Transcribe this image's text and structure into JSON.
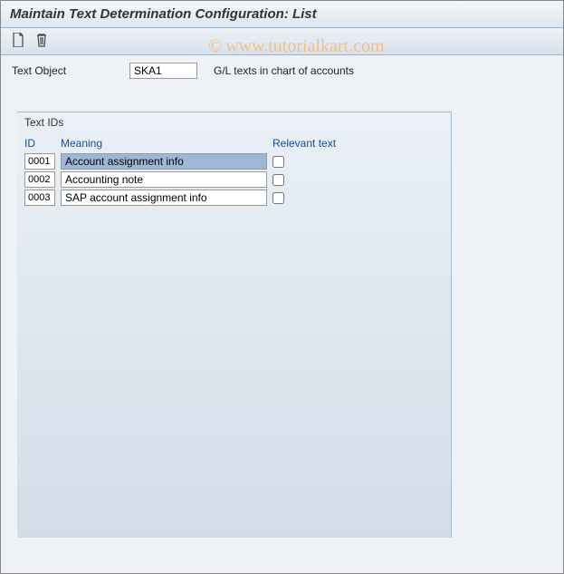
{
  "title": "Maintain Text Determination Configuration: List",
  "toolbar": {
    "new_tooltip": "New",
    "delete_tooltip": "Delete"
  },
  "text_object": {
    "label": "Text Object",
    "value": "SKA1",
    "description": "G/L texts in chart of accounts"
  },
  "panel": {
    "title": "Text IDs",
    "headers": {
      "id": "ID",
      "meaning": "Meaning",
      "relevant": "Relevant text"
    },
    "rows": [
      {
        "id": "0001",
        "meaning": "Account assignment info",
        "relevant": false,
        "selected": true
      },
      {
        "id": "0002",
        "meaning": "Accounting note",
        "relevant": false,
        "selected": false
      },
      {
        "id": "0003",
        "meaning": "SAP account assignment info",
        "relevant": false,
        "selected": false
      }
    ]
  },
  "watermark": "www.tutorialkart.com"
}
